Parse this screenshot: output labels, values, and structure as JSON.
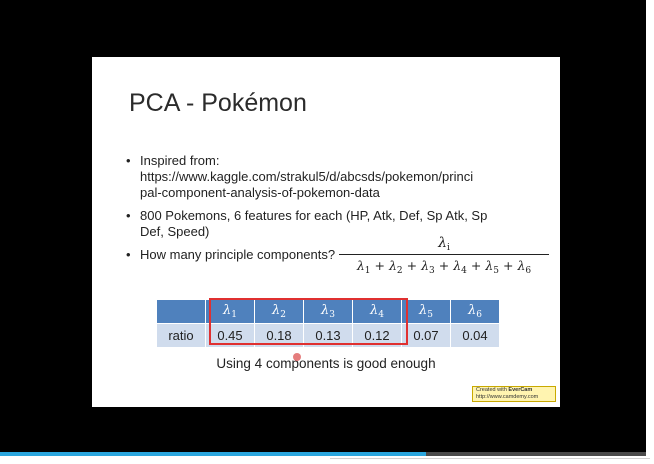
{
  "slide": {
    "title": "PCA - Pokémon",
    "bullets": [
      {
        "lines": [
          "Inspired from:",
          "https://www.kaggle.com/strakul5/d/abcsds/pokemon/princi",
          "pal-component-analysis-of-pokemon-data"
        ]
      },
      {
        "lines": [
          "800 Pokemons, 6 features for each (HP, Atk, Def, Sp Atk, Sp",
          "Def, Speed)"
        ]
      },
      {
        "lines": [
          "How many principle components?"
        ]
      }
    ],
    "formula": {
      "numerator_symbol": "λ",
      "numerator_sub": "i",
      "denominator_terms": [
        {
          "symbol": "λ",
          "sub": "1"
        },
        {
          "symbol": "λ",
          "sub": "2"
        },
        {
          "symbol": "λ",
          "sub": "3"
        },
        {
          "symbol": "λ",
          "sub": "4"
        },
        {
          "symbol": "λ",
          "sub": "5"
        },
        {
          "symbol": "λ",
          "sub": "6"
        }
      ],
      "operator": "+"
    },
    "table": {
      "header": [
        {
          "symbol": "λ",
          "sub": "1"
        },
        {
          "symbol": "λ",
          "sub": "2"
        },
        {
          "symbol": "λ",
          "sub": "3"
        },
        {
          "symbol": "λ",
          "sub": "4"
        },
        {
          "symbol": "λ",
          "sub": "5"
        },
        {
          "symbol": "λ",
          "sub": "6"
        }
      ],
      "row_label": "ratio",
      "values": [
        "0.45",
        "0.18",
        "0.13",
        "0.12",
        "0.07",
        "0.04"
      ]
    },
    "caption": "Using 4 components is good enough",
    "watermark": {
      "line1_prefix": "Created with ",
      "brand": "EverCam",
      "line2": "http://www.camdemy.com"
    }
  },
  "player": {
    "progress_fraction": 0.66,
    "accent_color": "#2aa6de",
    "highlight_color": "#e03030"
  }
}
